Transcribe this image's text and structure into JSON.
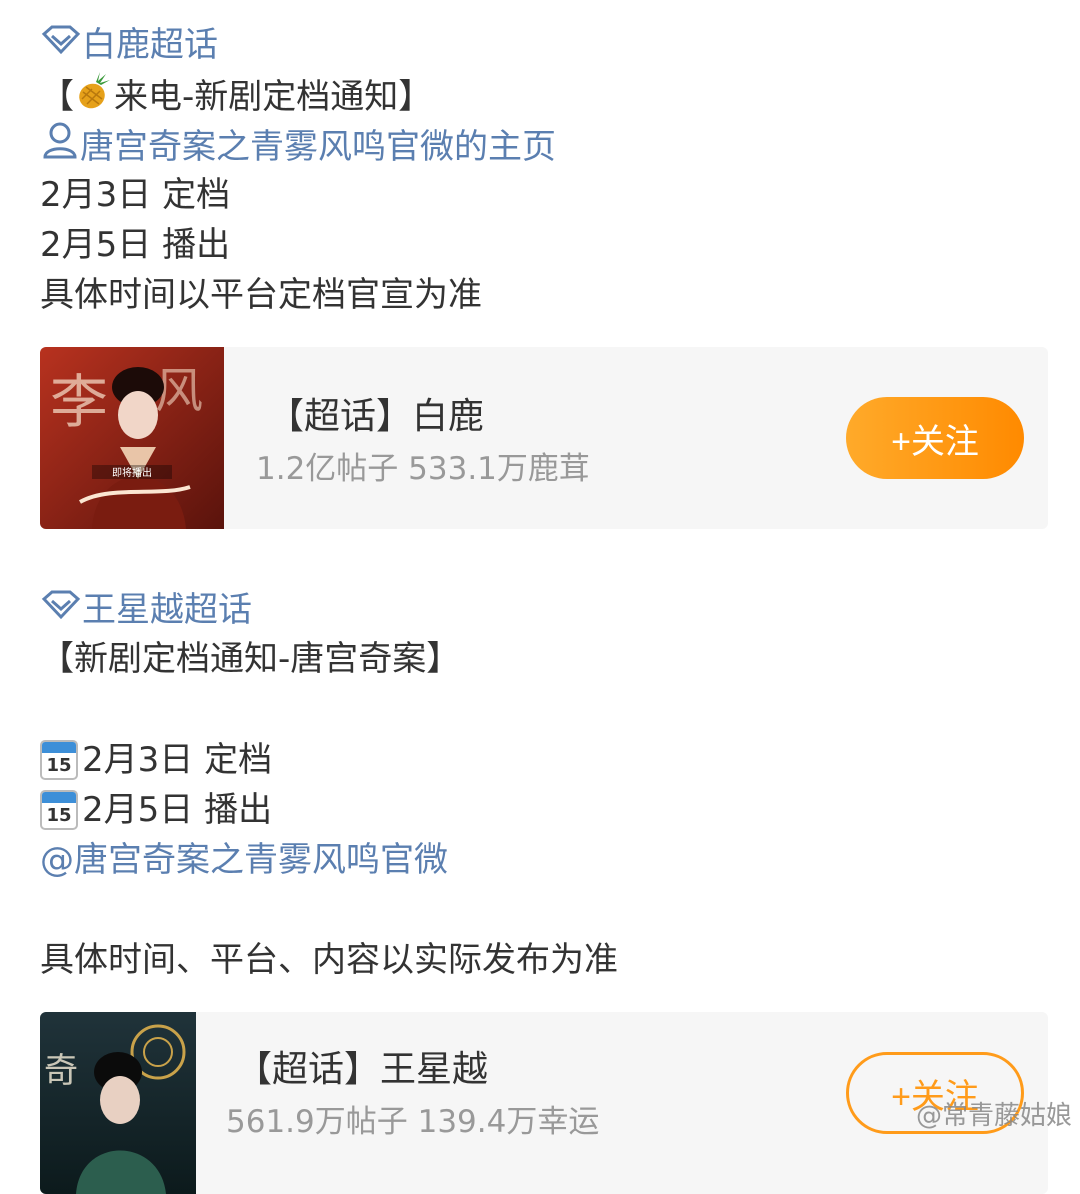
{
  "post1": {
    "topic": "白鹿超话",
    "headline_open": "【",
    "headline_text": "来电-新剧定档通知】",
    "profile_link": "唐宫奇案之青雾风鸣官微的主页",
    "line1": "2月3日 定档",
    "line2": "2月5日 播出",
    "line3": "具体时间以平台定档官宣为准"
  },
  "card1": {
    "title": "【超话】白鹿",
    "stats": "1.2亿帖子 533.1万鹿茸",
    "follow_label": "+关注",
    "poster_caption": "即将播出"
  },
  "post2": {
    "topic": "王星越超话",
    "headline": "【新剧定档通知-唐宫奇案】",
    "line1": "2月3日 定档",
    "line2": "2月5日 播出",
    "mention": "@唐宫奇案之青雾风鸣官微",
    "note": "具体时间、平台、内容以实际发布为准",
    "calendar_day": "15"
  },
  "card2": {
    "title": "【超话】王星越",
    "stats": "561.9万帖子 139.4万幸运",
    "follow_label": "+关注"
  },
  "watermark": "@常青藤姑娘"
}
